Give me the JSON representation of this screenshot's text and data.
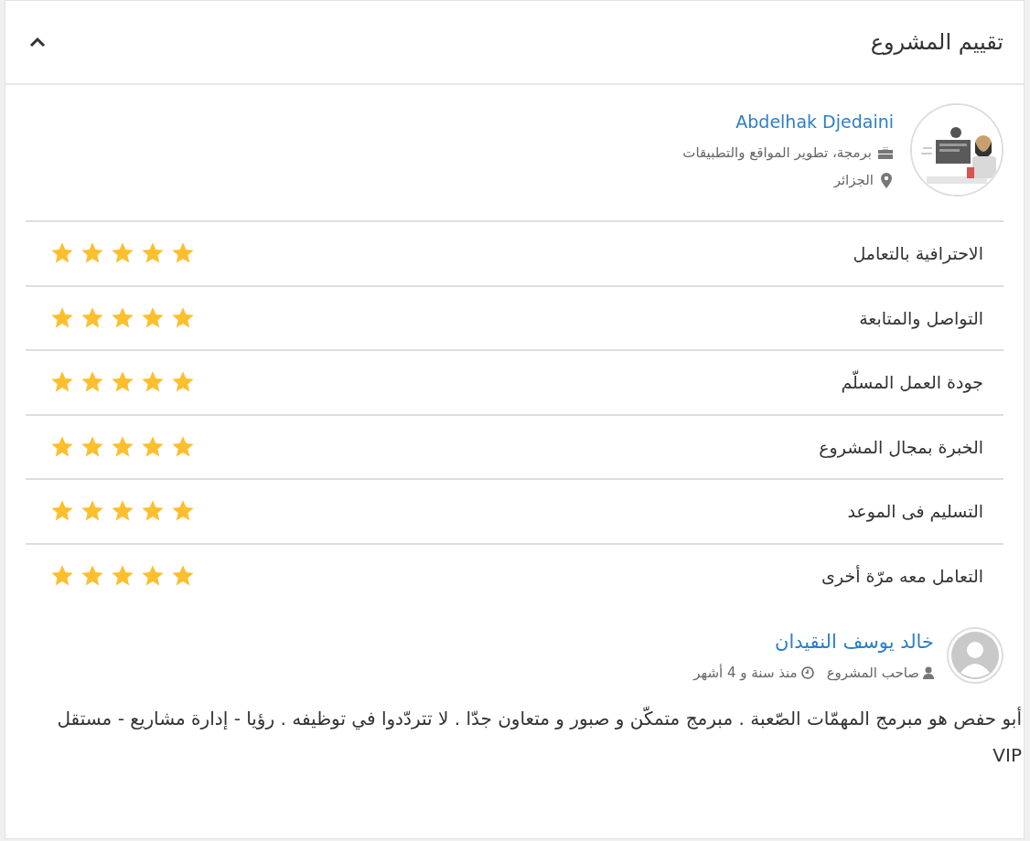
{
  "panel": {
    "title": "تقييم المشروع",
    "expanded": true
  },
  "freelancer": {
    "name": "Abdelhak Djedaini",
    "specialty": "برمجة، تطوير المواقع والتطبيقات",
    "country": "الجزائر"
  },
  "ratings": [
    {
      "label": "الاحترافية بالتعامل",
      "stars": 5
    },
    {
      "label": "التواصل والمتابعة",
      "stars": 5
    },
    {
      "label": "جودة العمل المسلّم",
      "stars": 5
    },
    {
      "label": "الخبرة بمجال المشروع",
      "stars": 5
    },
    {
      "label": "التسليم فى الموعد",
      "stars": 5
    },
    {
      "label": "التعامل معه مرّة أخرى",
      "stars": 5
    }
  ],
  "review": {
    "author": "خالد يوسف النقيدان",
    "role": "صاحب المشروع",
    "time": "منذ سنة و 4 أشهر",
    "text": "أبو حفص هو مبرمج المهمّات الصّعبة . مبرمج متمكّن و صبور و متعاون جدّا . لا تتردّدوا في توظيفه . رؤيا - إدارة مشاريع - مستقل VIP"
  }
}
